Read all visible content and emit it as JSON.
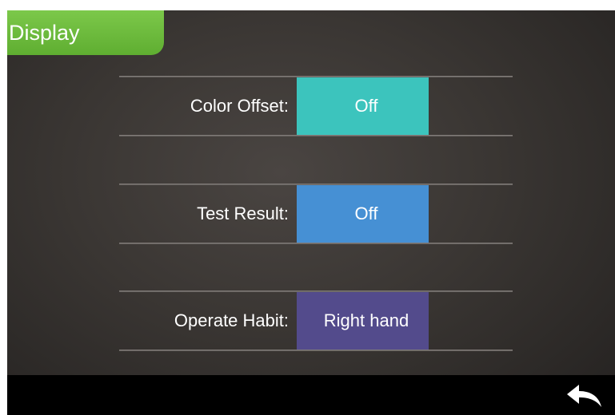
{
  "header": {
    "title": "Display"
  },
  "settings": [
    {
      "label": "Color Offset:",
      "value": "Off",
      "color": "#3cc4bd"
    },
    {
      "label": "Test Result:",
      "value": "Off",
      "color": "#4690d4"
    },
    {
      "label": "Operate Habit:",
      "value": "Right hand",
      "color": "#534b8c"
    }
  ],
  "footer": {
    "back_icon": "back-arrow-icon"
  }
}
